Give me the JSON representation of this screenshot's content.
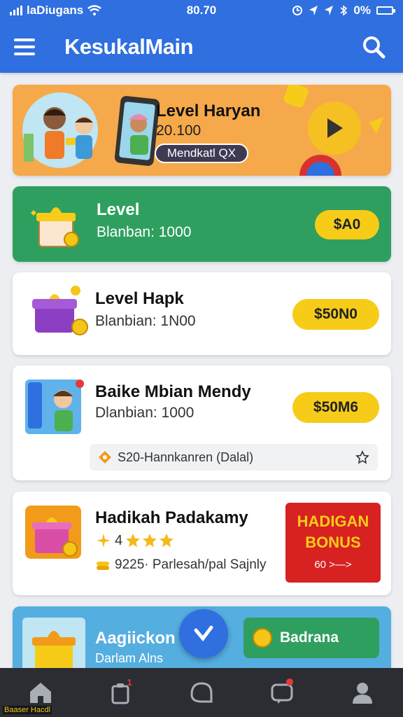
{
  "status_bar": {
    "carrier": "laDiugans",
    "time": "80.70",
    "battery": "0%"
  },
  "app_bar": {
    "title": "KesukalMain"
  },
  "cards": [
    {
      "title": "Level Haryan",
      "value": "20.100",
      "button": "Mendkatl QX"
    },
    {
      "title": "Level",
      "subtitle": "Blanban: 1000",
      "button": "$A0"
    },
    {
      "title": "Level Hapk",
      "subtitle": "Blanbian: 1N00",
      "button": "$50N0"
    },
    {
      "title": "Baike Mbian Mendy",
      "subtitle": "Dlanbian: 1000",
      "button": "$50M6",
      "info": "S20-Hannkanren (Dalal)"
    },
    {
      "title": "Hadikah Padakamy",
      "rating": 4,
      "info": "9225· Parlesah/pal Sajnly",
      "badge_line1": "HADIGAN",
      "badge_line2": "BONUS",
      "badge_sub": "60 >—>"
    },
    {
      "title": "Aagiickon",
      "subtitle": "Darlam Alns",
      "chip": "Badrana"
    }
  ],
  "bottom_nav": {
    "badge_count": "1",
    "watermark": "Baaser Hacdl"
  },
  "colors": {
    "primary": "#2f6fe0",
    "orange_card": "#f6a94a",
    "green_card": "#2f9f5f",
    "pill_yellow": "#f6cc19",
    "bonus_red": "#d82121",
    "nav_bg": "#2b2d33"
  }
}
